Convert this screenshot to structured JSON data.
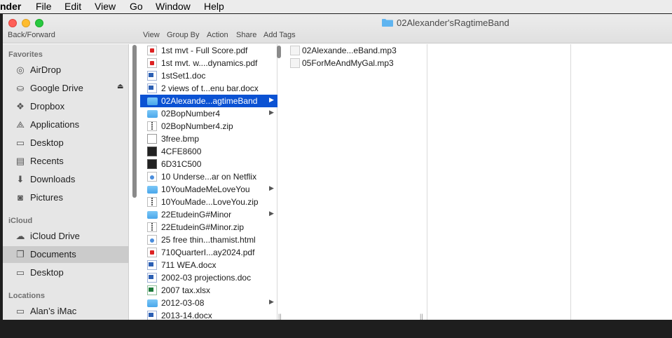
{
  "menubar": {
    "app": "nder",
    "items": [
      "File",
      "Edit",
      "View",
      "Go",
      "Window",
      "Help"
    ]
  },
  "window": {
    "title": "02Alexander'sRagtimeBand",
    "toolbar": {
      "back_forward": "Back/Forward",
      "view": "View",
      "group_by": "Group By",
      "action": "Action",
      "share": "Share",
      "add_tags": "Add Tags"
    }
  },
  "sidebar": {
    "favorites_header": "Favorites",
    "favorites": [
      {
        "label": "AirDrop",
        "icon": "airdrop-icon"
      },
      {
        "label": "Google Drive",
        "icon": "drive-icon"
      },
      {
        "label": "Dropbox",
        "icon": "dropbox-icon"
      },
      {
        "label": "Applications",
        "icon": "applications-icon"
      },
      {
        "label": "Desktop",
        "icon": "desktop-icon"
      },
      {
        "label": "Recents",
        "icon": "recents-icon"
      },
      {
        "label": "Downloads",
        "icon": "downloads-icon"
      },
      {
        "label": "Pictures",
        "icon": "pictures-icon"
      }
    ],
    "icloud_header": "iCloud",
    "icloud": [
      {
        "label": "iCloud Drive",
        "icon": "cloud-icon"
      },
      {
        "label": "Documents",
        "icon": "documents-icon"
      },
      {
        "label": "Desktop",
        "icon": "desktop-icon"
      }
    ],
    "locations_header": "Locations",
    "locations": [
      {
        "label": "Alan’s iMac",
        "icon": "imac-icon"
      }
    ]
  },
  "column1": {
    "files": [
      {
        "name": "1st mvt - Full Score.pdf",
        "type": "pdf"
      },
      {
        "name": "1st mvt. w....dynamics.pdf",
        "type": "pdf"
      },
      {
        "name": "1stSet1.doc",
        "type": "doc"
      },
      {
        "name": "2 views of t...enu bar.docx",
        "type": "doc"
      },
      {
        "name": "02Alexande...agtimeBand",
        "type": "folder"
      },
      {
        "name": "02BopNumber4",
        "type": "folder"
      },
      {
        "name": "02BopNumber4.zip",
        "type": "zip"
      },
      {
        "name": "3free.bmp",
        "type": "bmp"
      },
      {
        "name": "4CFE8600",
        "type": "black"
      },
      {
        "name": "6D31C500",
        "type": "black"
      },
      {
        "name": "10 Underse...ar on Netflix",
        "type": "generic"
      },
      {
        "name": "10YouMadeMeLoveYou",
        "type": "folder"
      },
      {
        "name": "10YouMade...LoveYou.zip",
        "type": "zip"
      },
      {
        "name": "22EtudeinG#Minor",
        "type": "folder"
      },
      {
        "name": "22EtudeinG#Minor.zip",
        "type": "zip"
      },
      {
        "name": "25 free thin...thamist.html",
        "type": "generic"
      },
      {
        "name": "710QuarterI...ay2024.pdf",
        "type": "pdf"
      },
      {
        "name": "711 WEA.docx",
        "type": "doc"
      },
      {
        "name": "2002-03 projections.doc",
        "type": "doc"
      },
      {
        "name": "2007 tax.xlsx",
        "type": "xls"
      },
      {
        "name": "2012-03-08",
        "type": "folder"
      },
      {
        "name": "2013-14.docx",
        "type": "doc"
      }
    ]
  },
  "column2": {
    "files": [
      {
        "name": "02Alexande...eBand.mp3",
        "type": "mp3"
      },
      {
        "name": "05ForMeAndMyGal.mp3",
        "type": "mp3"
      }
    ]
  },
  "colors": {
    "selection": "#0b52d3",
    "sidebar_bg": "#e6e6e6",
    "close": "#fe5f57",
    "minimize": "#febc2e",
    "zoom": "#28c840",
    "folder": "#5fb4f0"
  }
}
